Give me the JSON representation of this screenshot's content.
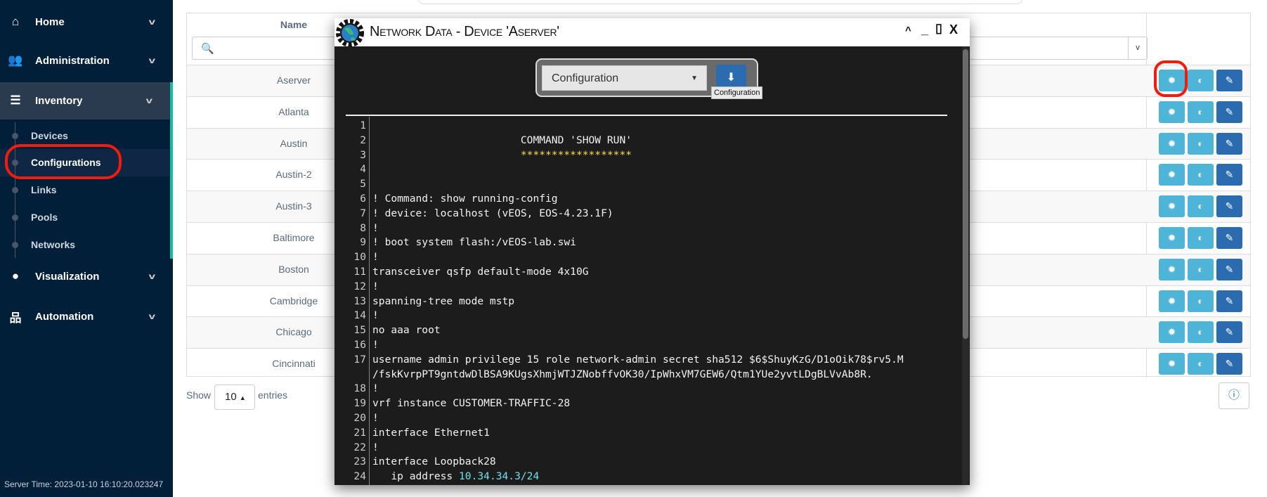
{
  "sidebar": {
    "items": [
      {
        "label": "Home",
        "icon": "home-icon"
      },
      {
        "label": "Administration",
        "icon": "users-icon"
      },
      {
        "label": "Inventory",
        "icon": "database-icon"
      },
      {
        "label": "Visualization",
        "icon": "map-marker-icon"
      },
      {
        "label": "Automation",
        "icon": "sitemap-icon"
      }
    ],
    "inventory_sub": [
      "Devices",
      "Configurations",
      "Links",
      "Pools",
      "Networks"
    ],
    "active": "Configurations",
    "server_time": "Server Time: 2023-01-10 16:10:20.023247"
  },
  "table": {
    "name_header": "Name",
    "rows": [
      "Aserver",
      "Atlanta",
      "Austin",
      "Austin-2",
      "Austin-3",
      "Baltimore",
      "Boston",
      "Cambridge",
      "Chicago",
      "Cincinnati"
    ],
    "show_label": "Show",
    "page_length": "10",
    "entries_label": "entries"
  },
  "modal": {
    "title": "Network Data - Device 'Aserver'",
    "select_value": "Configuration",
    "download_tooltip": "Configuration",
    "lines": [
      {
        "n": "1",
        "t": ""
      },
      {
        "n": "2",
        "t": "                        COMMAND 'SHOW RUN'"
      },
      {
        "n": "3",
        "t": "                        ******************",
        "c": "yel"
      },
      {
        "n": "4",
        "t": ""
      },
      {
        "n": "5",
        "t": ""
      },
      {
        "n": "6",
        "t": "! Command: show running-config"
      },
      {
        "n": "7",
        "t": "! device: localhost (vEOS, EOS-4.23.1F)"
      },
      {
        "n": "8",
        "t": "!"
      },
      {
        "n": "9",
        "t": "! boot system flash:/vEOS-lab.swi"
      },
      {
        "n": "10",
        "t": "!"
      },
      {
        "n": "11",
        "t": "transceiver qsfp default-mode 4x10G"
      },
      {
        "n": "12",
        "t": "!"
      },
      {
        "n": "13",
        "t": "spanning-tree mode mstp"
      },
      {
        "n": "14",
        "t": "!"
      },
      {
        "n": "15",
        "t": "no aaa root"
      },
      {
        "n": "16",
        "t": "!"
      },
      {
        "n": "17",
        "t": "username admin privilege 15 role network-admin secret sha512 $6$ShuyKzG/D1oOik78$rv5.M"
      },
      {
        "n": "",
        "t": "/fskKvrpPT9gntdwDlBSA9KUgsXhmjWTJZNobffvOK30/IpWhxVM7GEW6/Qtm1YUe2yvtLDgBLVvAb8R."
      },
      {
        "n": "18",
        "t": "!"
      },
      {
        "n": "19",
        "t": "vrf instance CUSTOMER-TRAFFIC-28"
      },
      {
        "n": "20",
        "t": "!"
      },
      {
        "n": "21",
        "t": "interface Ethernet1"
      },
      {
        "n": "22",
        "t": "!"
      },
      {
        "n": "23",
        "t": "interface Loopback28"
      },
      {
        "n": "24",
        "t": "   ip address ",
        "hl": "10.34.34.3/24"
      }
    ]
  },
  "colors": {
    "sidebar": "#021f3a",
    "accent": "#1abb9c",
    "btn_info": "#4fb5d8",
    "btn_primary": "#2b6cb0",
    "highlight_ring": "#f21b0c"
  }
}
